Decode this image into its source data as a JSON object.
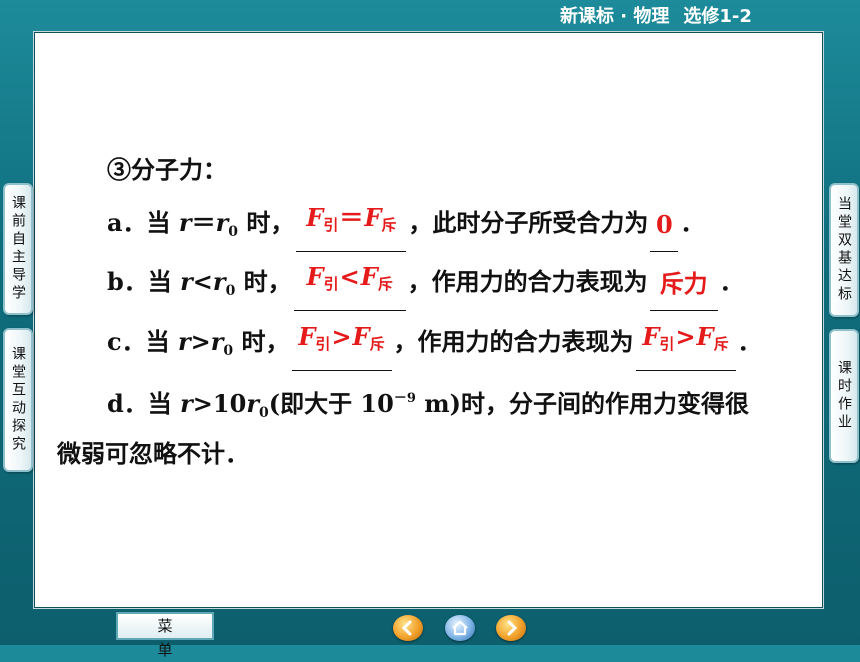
{
  "header": {
    "course": "新课标 · 物理",
    "module": "选修1-2"
  },
  "side_tabs": {
    "left": [
      "课前自主导学",
      "课堂互动探究"
    ],
    "right": [
      "当堂双基达标",
      "课时作业"
    ]
  },
  "content": {
    "heading": "③分子力：",
    "a": {
      "prefix": "a．当 ",
      "var": "r",
      "mid": "＝",
      "var2": "r",
      "sub0": "0",
      "after_cond": " 时，",
      "after_blank": "，此时分子所受合力为",
      "end": "．",
      "answer_blank1": {
        "f1": "F",
        "s1": "引",
        "op": "＝",
        "f2": "F",
        "s2": "斥"
      },
      "answer_blank2": "0"
    },
    "b": {
      "prefix": "b．当 ",
      "var": "r",
      "op": "<",
      "var2": "r",
      "sub0": "0",
      "after_cond": " 时，",
      "after_blank": "，作用力的合力表现为",
      "end": "．",
      "answer_blank1": {
        "f1": "F",
        "s1": "引",
        "op": "<",
        "f2": "F",
        "s2": "斥"
      },
      "answer_blank2": "斥力"
    },
    "c": {
      "prefix": "c．当 ",
      "var": "r",
      "op": ">",
      "var2": "r",
      "sub0": "0",
      "after_cond": " 时，",
      "after_blank": "，作用力的合力表现为",
      "end": "．",
      "answer_blank1": {
        "f1": "F",
        "s1": "引",
        "op": ">",
        "f2": "F",
        "s2": "斥"
      },
      "answer_blank2": {
        "f1": "F",
        "s1": "引",
        "op": ">",
        "f2": "F",
        "s2": "斥"
      }
    },
    "d": {
      "prefix": "d．当 ",
      "var": "r",
      "op": ">10",
      "var2": "r",
      "sub0": "0",
      "paren": "(即大于 10",
      "exp": "－9",
      "unit": " m)时，分子间的作用力变得很"
    },
    "d_cont": "微弱可忽略不计．"
  },
  "footer": {
    "menu_label": "菜单"
  },
  "icons": {
    "prev": "arrow-left-icon",
    "home": "home-icon",
    "next": "arrow-right-icon"
  }
}
